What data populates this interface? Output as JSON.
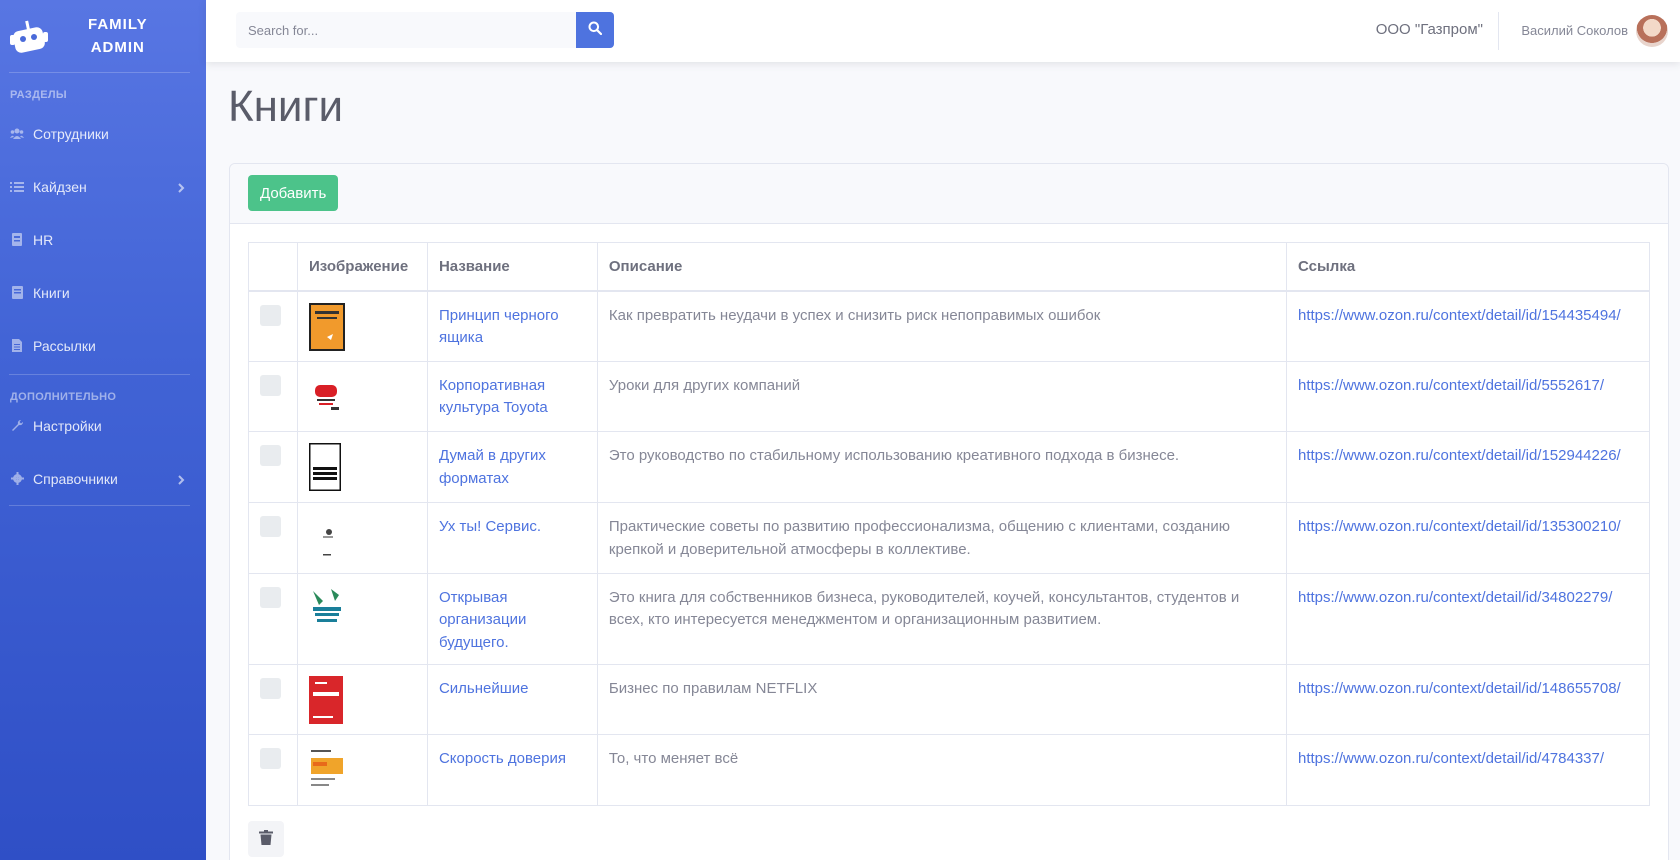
{
  "sidebar": {
    "brand_line1": "FAMILY",
    "brand_line2": "ADMIN",
    "heading1": "РАЗДЕЛЫ",
    "heading2": "ДОПОЛНИТЕЛЬНО",
    "items": [
      {
        "label": "Сотрудники",
        "icon": "users-icon"
      },
      {
        "label": "Кайдзен",
        "icon": "list-icon",
        "has_submenu": true
      },
      {
        "label": "HR",
        "icon": "id-card-icon"
      },
      {
        "label": "Книги",
        "icon": "book-icon"
      },
      {
        "label": "Рассылки",
        "icon": "file-icon"
      },
      {
        "label": "Настройки",
        "icon": "wrench-icon"
      },
      {
        "label": "Справочники",
        "icon": "cog-icon",
        "has_submenu": true
      }
    ]
  },
  "topbar": {
    "search_placeholder": "Search for...",
    "company": "ООО \"Газпром\"",
    "user_name": "Василий Соколов"
  },
  "page": {
    "title": "Книги",
    "add_label": "Добавить"
  },
  "table": {
    "headers": [
      "",
      "Изображение",
      "Название",
      "Описание",
      "Ссылка"
    ],
    "rows": [
      {
        "title": "Принцип черного ящика",
        "description": "Как превратить неудачи в успех и снизить риск непоправимых ошибок",
        "link": "https://www.ozon.ru/context/detail/id/154435494/",
        "cover": "orange-cover"
      },
      {
        "title": "Корпоративная культура Toyota",
        "description": "Уроки для других компаний",
        "link": "https://www.ozon.ru/context/detail/id/5552617/",
        "cover": "red-white-cover"
      },
      {
        "title": "Думай в других форматах",
        "description": "Это руководство по стабильному использованию креативного подхода в бизнесе.",
        "link": "https://www.ozon.ru/context/detail/id/152944226/",
        "cover": "white-black-cover"
      },
      {
        "title": "Ух ты! Сервис.",
        "description": "Практические советы по развитию профессионализма, общению с клиентами, созданию крепкой и доверительной атмосферы в коллективе.",
        "link": "https://www.ozon.ru/context/detail/id/135300210/",
        "cover": "white-cover"
      },
      {
        "title": "Открывая организации будущего.",
        "description": "Это книга для собственников бизнеса, руководителей, коучей, консультантов, студентов и всех, кто интересуется менеджментом и организационным развитием.",
        "link": "https://www.ozon.ru/context/detail/id/34802279/",
        "cover": "teal-cover"
      },
      {
        "title": "Сильнейшие",
        "description": "Бизнес по правилам NETFLIX",
        "link": "https://www.ozon.ru/context/detail/id/148655708/",
        "cover": "red-cover"
      },
      {
        "title": "Скорость доверия",
        "description": "То, что меняет всё",
        "link": "https://www.ozon.ru/context/detail/id/4784337/",
        "cover": "yellow-cover"
      }
    ]
  },
  "colors": {
    "primary": "#4e73df",
    "success": "#4cc38a"
  }
}
